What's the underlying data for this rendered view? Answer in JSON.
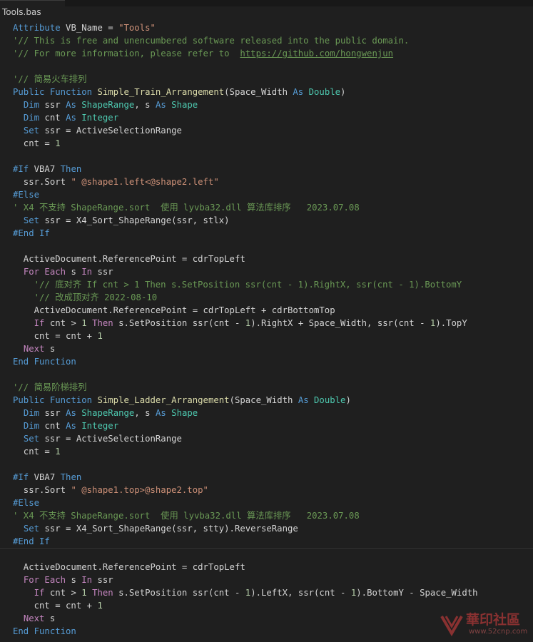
{
  "tab": {
    "title": "Tools.bas",
    "icon": "vb-file-icon"
  },
  "watermark": {
    "text": "華印社區",
    "url": "www.52cnp.com",
    "icon": "logo-icon"
  },
  "colors": {
    "background": "#1f1f1f",
    "keyword": "#569cd6",
    "control": "#c586c0",
    "type": "#4ec9b0",
    "function": "#dcdcaa",
    "string": "#ce9178",
    "comment": "#6a9955",
    "number": "#b5cea8"
  },
  "code": [
    [
      [
        "kw",
        "Attribute"
      ],
      [
        "var",
        " VB_Name = "
      ],
      [
        "str",
        "\"Tools\""
      ]
    ],
    [
      [
        "cm",
        "'// This is free and unencumbered software released into the public domain."
      ]
    ],
    [
      [
        "cm",
        "'// For more information, please refer to  "
      ],
      [
        "lnk",
        "https://github.com/hongwenjun"
      ]
    ],
    [],
    [
      [
        "cm",
        "'// 简易火车排列"
      ]
    ],
    [
      [
        "kw",
        "Public Function "
      ],
      [
        "fn",
        "Simple_Train_Arrangement"
      ],
      [
        "var",
        "(Space_Width "
      ],
      [
        "kw",
        "As "
      ],
      [
        "ty",
        "Double"
      ],
      [
        "var",
        ")"
      ]
    ],
    [
      [
        "var",
        "  "
      ],
      [
        "kw",
        "Dim "
      ],
      [
        "var",
        "ssr "
      ],
      [
        "kw",
        "As "
      ],
      [
        "ty",
        "ShapeRange"
      ],
      [
        "var",
        ", s "
      ],
      [
        "kw",
        "As "
      ],
      [
        "ty",
        "Shape"
      ]
    ],
    [
      [
        "var",
        "  "
      ],
      [
        "kw",
        "Dim "
      ],
      [
        "var",
        "cnt "
      ],
      [
        "kw",
        "As "
      ],
      [
        "ty",
        "Integer"
      ]
    ],
    [
      [
        "var",
        "  "
      ],
      [
        "kw",
        "Set "
      ],
      [
        "var",
        "ssr = ActiveSelectionRange"
      ]
    ],
    [
      [
        "var",
        "  cnt = "
      ],
      [
        "num",
        "1"
      ]
    ],
    [],
    [
      [
        "kw",
        "#If "
      ],
      [
        "var",
        "VBA7 "
      ],
      [
        "kw",
        "Then"
      ]
    ],
    [
      [
        "var",
        "  ssr.Sort "
      ],
      [
        "str",
        "\" @shape1.left<@shape2.left\""
      ]
    ],
    [
      [
        "kw",
        "#Else"
      ]
    ],
    [
      [
        "cm",
        "' X4 不支持 ShapeRange.sort  使用 lyvba32.dll 算法库排序   2023.07.08"
      ]
    ],
    [
      [
        "var",
        "  "
      ],
      [
        "kw",
        "Set "
      ],
      [
        "var",
        "ssr = X4_Sort_ShapeRange(ssr, stlx)"
      ]
    ],
    [
      [
        "kw",
        "#End If"
      ]
    ],
    [],
    [
      [
        "var",
        "  ActiveDocument.ReferencePoint = cdrTopLeft"
      ]
    ],
    [
      [
        "var",
        "  "
      ],
      [
        "ctl",
        "For Each "
      ],
      [
        "var",
        "s "
      ],
      [
        "ctl",
        "In "
      ],
      [
        "var",
        "ssr"
      ]
    ],
    [
      [
        "var",
        "    "
      ],
      [
        "cm",
        "'// 底对齐 If cnt > 1 Then s.SetPosition ssr(cnt - 1).RightX, ssr(cnt - 1).BottomY"
      ]
    ],
    [
      [
        "var",
        "    "
      ],
      [
        "cm",
        "'// 改成顶对齐 2022-08-10"
      ]
    ],
    [
      [
        "var",
        "    ActiveDocument.ReferencePoint = cdrTopLeft + cdrBottomTop"
      ]
    ],
    [
      [
        "var",
        "    "
      ],
      [
        "ctl",
        "If "
      ],
      [
        "var",
        "cnt > "
      ],
      [
        "num",
        "1"
      ],
      [
        "ctl",
        " Then "
      ],
      [
        "var",
        "s.SetPosition ssr(cnt - "
      ],
      [
        "num",
        "1"
      ],
      [
        "var",
        ").RightX + Space_Width, ssr(cnt - "
      ],
      [
        "num",
        "1"
      ],
      [
        "var",
        ").TopY"
      ]
    ],
    [
      [
        "var",
        "    cnt = cnt + "
      ],
      [
        "num",
        "1"
      ]
    ],
    [
      [
        "var",
        "  "
      ],
      [
        "ctl",
        "Next "
      ],
      [
        "var",
        "s"
      ]
    ],
    [
      [
        "kw",
        "End Function"
      ]
    ],
    [],
    [
      [
        "cm",
        "'// 简易阶梯排列"
      ]
    ],
    [
      [
        "kw",
        "Public Function "
      ],
      [
        "fn",
        "Simple_Ladder_Arrangement"
      ],
      [
        "var",
        "(Space_Width "
      ],
      [
        "kw",
        "As "
      ],
      [
        "ty",
        "Double"
      ],
      [
        "var",
        ")"
      ]
    ],
    [
      [
        "var",
        "  "
      ],
      [
        "kw",
        "Dim "
      ],
      [
        "var",
        "ssr "
      ],
      [
        "kw",
        "As "
      ],
      [
        "ty",
        "ShapeRange"
      ],
      [
        "var",
        ", s "
      ],
      [
        "kw",
        "As "
      ],
      [
        "ty",
        "Shape"
      ]
    ],
    [
      [
        "var",
        "  "
      ],
      [
        "kw",
        "Dim "
      ],
      [
        "var",
        "cnt "
      ],
      [
        "kw",
        "As "
      ],
      [
        "ty",
        "Integer"
      ]
    ],
    [
      [
        "var",
        "  "
      ],
      [
        "kw",
        "Set "
      ],
      [
        "var",
        "ssr = ActiveSelectionRange"
      ]
    ],
    [
      [
        "var",
        "  cnt = "
      ],
      [
        "num",
        "1"
      ]
    ],
    [],
    [
      [
        "kw",
        "#If "
      ],
      [
        "var",
        "VBA7 "
      ],
      [
        "kw",
        "Then"
      ]
    ],
    [
      [
        "var",
        "  ssr.Sort "
      ],
      [
        "str",
        "\" @shape1.top>@shape2.top\""
      ]
    ],
    [
      [
        "kw",
        "#Else"
      ]
    ],
    [
      [
        "cm",
        "' X4 不支持 ShapeRange.sort  使用 lyvba32.dll 算法库排序   2023.07.08"
      ]
    ],
    [
      [
        "var",
        "  "
      ],
      [
        "kw",
        "Set "
      ],
      [
        "var",
        "ssr = X4_Sort_ShapeRange(ssr, stty).ReverseRange"
      ]
    ],
    [
      [
        "kw",
        "#End If"
      ]
    ],
    [],
    [
      [
        "var",
        "  ActiveDocument.ReferencePoint = cdrTopLeft"
      ]
    ],
    [
      [
        "var",
        "  "
      ],
      [
        "ctl",
        "For Each "
      ],
      [
        "var",
        "s "
      ],
      [
        "ctl",
        "In "
      ],
      [
        "var",
        "ssr"
      ]
    ],
    [
      [
        "var",
        "    "
      ],
      [
        "ctl",
        "If "
      ],
      [
        "var",
        "cnt > "
      ],
      [
        "num",
        "1"
      ],
      [
        "ctl",
        " Then "
      ],
      [
        "var",
        "s.SetPosition ssr(cnt - "
      ],
      [
        "num",
        "1"
      ],
      [
        "var",
        ").LeftX, ssr(cnt - "
      ],
      [
        "num",
        "1"
      ],
      [
        "var",
        ").BottomY - Space_Width"
      ]
    ],
    [
      [
        "var",
        "    cnt = cnt + "
      ],
      [
        "num",
        "1"
      ]
    ],
    [
      [
        "var",
        "  "
      ],
      [
        "ctl",
        "Next "
      ],
      [
        "var",
        "s"
      ]
    ],
    [
      [
        "kw",
        "End Function"
      ]
    ]
  ]
}
